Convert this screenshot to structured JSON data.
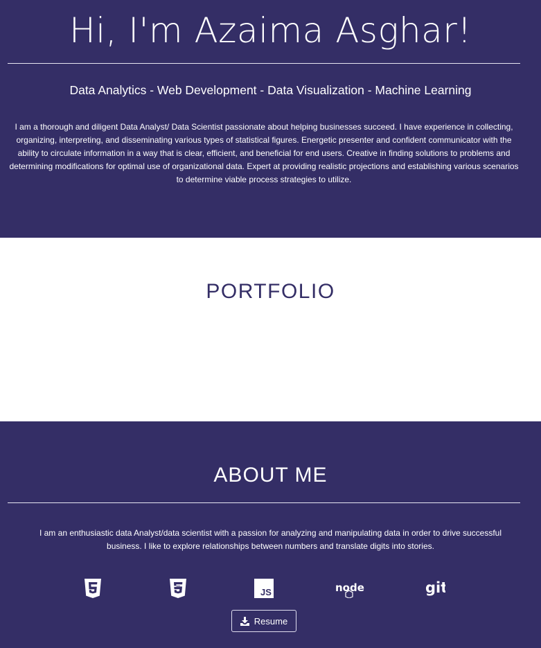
{
  "hero": {
    "title": "Hi, I'm Azaima Asghar!",
    "subtitle": "Data Analytics - Web Development - Data Visualization - Machine Learning",
    "bio": "I am a thorough and diligent Data Analyst/ Data Scientist passionate about helping businesses succeed. I have experience in collecting, organizing, interpreting, and disseminating various types of statistical figures. Energetic presenter and confident communicator with the ability to circulate information in a way that is clear, efficient, and beneficial for end users. Creative in finding solutions to problems and determining modifications for optimal use of organizational data. Expert at providing realistic projections and establishing various scenarios to determine viable process strategies to utilize."
  },
  "portfolio": {
    "title": "PORTFOLIO"
  },
  "about": {
    "title": "ABOUT ME",
    "text": "I am an enthusiastic data Analyst/data scientist with a passion for analyzing and manipulating data in order to drive successful business. I like to explore relationships between numbers and translate digits into stories.",
    "icons": [
      "html5-icon",
      "css3-icon",
      "javascript-icon",
      "nodejs-icon",
      "git-icon"
    ],
    "resume_label": "Resume"
  },
  "colors": {
    "primary": "#342e66",
    "background_light": "#ffffff",
    "text_light": "#ffffff"
  }
}
